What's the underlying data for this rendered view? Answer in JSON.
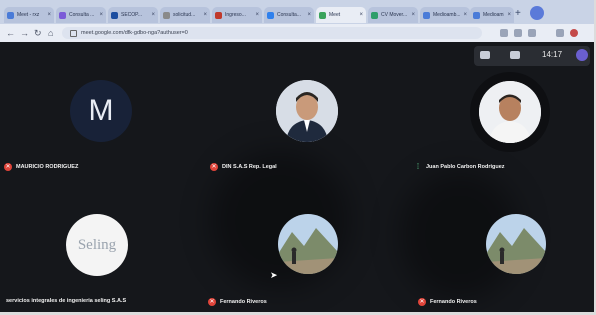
{
  "browser": {
    "tabs": [
      {
        "label": "Meet - rxz",
        "color": "#4a7bd8"
      },
      {
        "label": "Consulta ...",
        "color": "#7b5bd8"
      },
      {
        "label": "SECOP...",
        "color": "#1d4ea0"
      },
      {
        "label": "solicitud...",
        "color": "#8a8a8a"
      },
      {
        "label": "Ingreso...",
        "color": "#c0392b"
      },
      {
        "label": "Consulta...",
        "color": "#2f80ed"
      },
      {
        "label": "Meet",
        "color": "#3aa35c"
      },
      {
        "label": "CV Mover...",
        "color": "#2e9e6a"
      },
      {
        "label": "Medioamb...",
        "color": "#4a7bd8"
      },
      {
        "label": "Medioamb...",
        "color": "#4a7bd8"
      }
    ],
    "new_tab_symbol": "+",
    "url": "meet.google.com/dfk-gdbo-nga?authuser=0"
  },
  "meet_bar": {
    "time": "14:17"
  },
  "participants": [
    {
      "name": "MAURICIO RODRIGUEZ",
      "avatar_type": "letter",
      "avatar_letter": "M",
      "muted": true
    },
    {
      "name": "DIN S.A.S Rep. Legal",
      "avatar_type": "photo",
      "muted": true
    },
    {
      "name": "Juan Pablo Carbon Rodriguez",
      "avatar_type": "photo",
      "muted": false
    },
    {
      "name": "servicios integrales de ingenieria seling S.A.S",
      "avatar_type": "logo",
      "logo_text": "Seling",
      "muted": null
    },
    {
      "name": "Fernando Riveros",
      "avatar_type": "photo",
      "muted": true
    },
    {
      "name": "Fernando Riveros",
      "avatar_type": "photo",
      "muted": true
    }
  ]
}
